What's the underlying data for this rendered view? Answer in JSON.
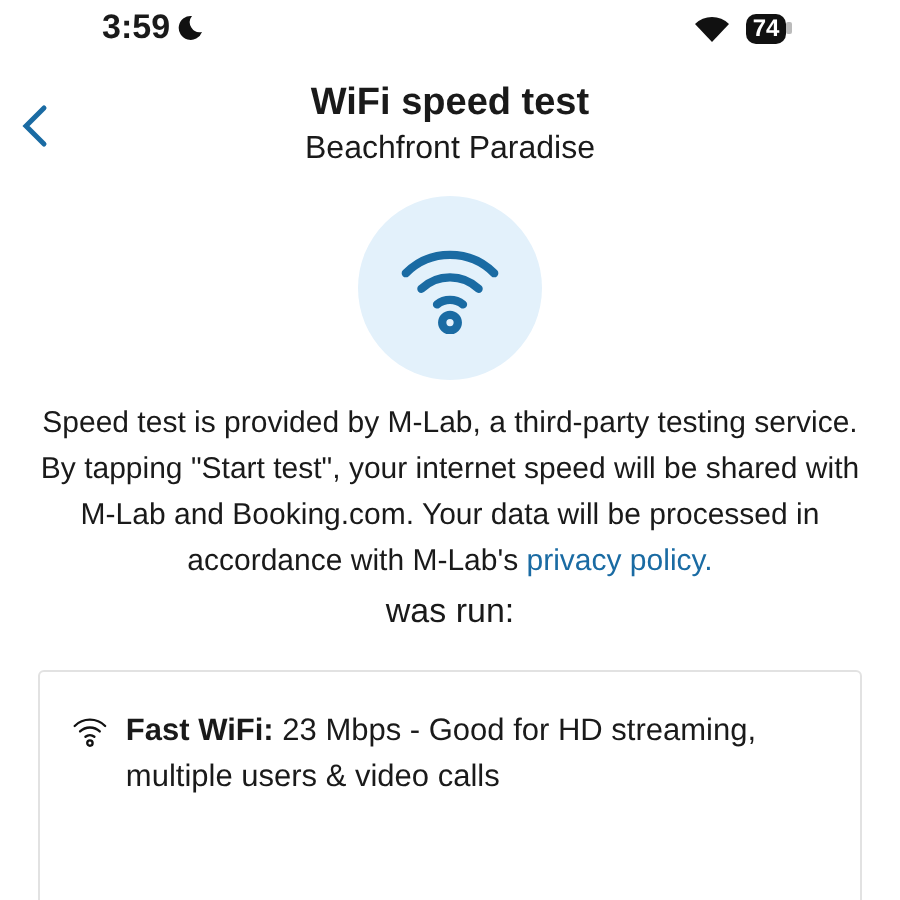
{
  "status_bar": {
    "time": "3:59",
    "battery": "74"
  },
  "header": {
    "title": "WiFi speed test",
    "subtitle": "Beachfront Paradise"
  },
  "disclaimer": {
    "text": "Speed test is provided by M-Lab, a third-party testing service. By tapping \"Start test\", your internet speed will be shared with M-Lab and Booking.com. Your data will be processed in accordance with M-Lab's",
    "link": "privacy policy."
  },
  "run_label": "was run:",
  "result": {
    "text": "**Fast WiFi:** 23 Mbps - Good for HD streaming, multiple users & video calls"
  }
}
